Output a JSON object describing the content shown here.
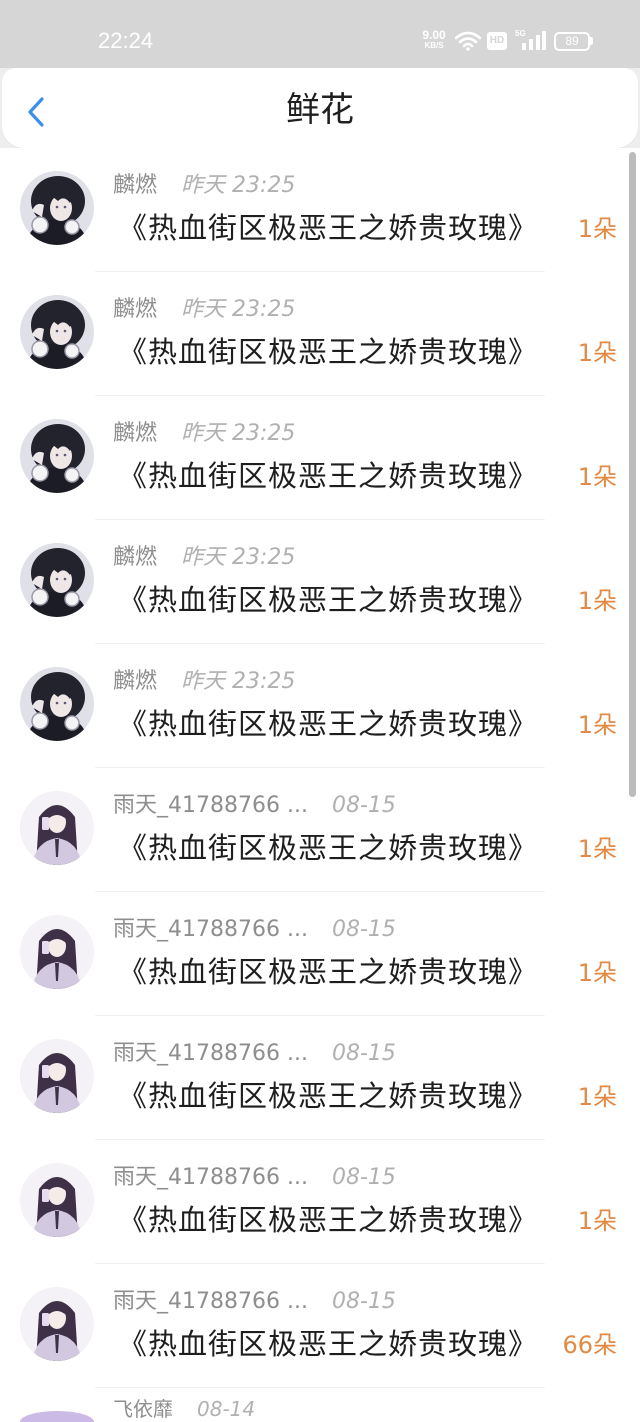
{
  "status_bar": {
    "time": "22:24",
    "net_speed": "9.00",
    "net_speed_unit": "KB/S",
    "hd_label": "HD",
    "network_type": "5G",
    "battery_level": "89"
  },
  "header": {
    "title": "鲜花",
    "back_icon": "chevron-left-icon"
  },
  "colors": {
    "status_bar": "#d6d6d6",
    "accent": "#3b8fe8",
    "count": "#e28a45",
    "name": "#8e8e8e",
    "time": "#b0b0b0",
    "title": "#1e1e1e"
  },
  "items": [
    {
      "name": "麟燃",
      "time": "昨天 23:25",
      "book": "《热血街区极恶王之娇贵玫瑰》",
      "count": "1朵",
      "avatar_style": "dark-hair-boy"
    },
    {
      "name": "麟燃",
      "time": "昨天 23:25",
      "book": "《热血街区极恶王之娇贵玫瑰》",
      "count": "1朵",
      "avatar_style": "dark-hair-boy"
    },
    {
      "name": "麟燃",
      "time": "昨天 23:25",
      "book": "《热血街区极恶王之娇贵玫瑰》",
      "count": "1朵",
      "avatar_style": "dark-hair-boy"
    },
    {
      "name": "麟燃",
      "time": "昨天 23:25",
      "book": "《热血街区极恶王之娇贵玫瑰》",
      "count": "1朵",
      "avatar_style": "dark-hair-boy"
    },
    {
      "name": "麟燃",
      "time": "昨天 23:25",
      "book": "《热血街区极恶王之娇贵玫瑰》",
      "count": "1朵",
      "avatar_style": "dark-hair-boy"
    },
    {
      "name": "雨天_41788766 ...",
      "time": "08-15",
      "book": "《热血街区极恶王之娇贵玫瑰》",
      "count": "1朵",
      "avatar_style": "purple-hair-girl"
    },
    {
      "name": "雨天_41788766 ...",
      "time": "08-15",
      "book": "《热血街区极恶王之娇贵玫瑰》",
      "count": "1朵",
      "avatar_style": "purple-hair-girl"
    },
    {
      "name": "雨天_41788766 ...",
      "time": "08-15",
      "book": "《热血街区极恶王之娇贵玫瑰》",
      "count": "1朵",
      "avatar_style": "purple-hair-girl"
    },
    {
      "name": "雨天_41788766 ...",
      "time": "08-15",
      "book": "《热血街区极恶王之娇贵玫瑰》",
      "count": "1朵",
      "avatar_style": "purple-hair-girl"
    },
    {
      "name": "雨天_41788766 ...",
      "time": "08-15",
      "book": "《热血街区极恶王之娇贵玫瑰》",
      "count": "66朵",
      "avatar_style": "purple-hair-girl"
    }
  ],
  "partial_item": {
    "name": "飞依靡",
    "time": "08-14"
  }
}
